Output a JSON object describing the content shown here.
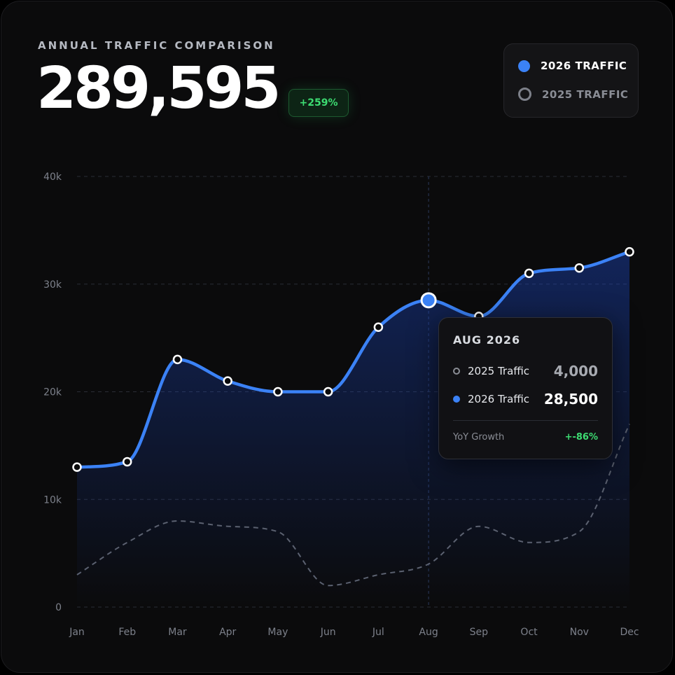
{
  "header": {
    "eyebrow": "ANNUAL TRAFFIC COMPARISON",
    "total": "289,595",
    "change_badge": "+259%"
  },
  "legend": {
    "items": [
      {
        "label": "2026 TRAFFIC",
        "style": "filled",
        "color": "#3b82f6"
      },
      {
        "label": "2025 TRAFFIC",
        "style": "hollow",
        "color": "#7d8089"
      }
    ]
  },
  "tooltip": {
    "title": "AUG 2026",
    "row_2025_label": "2025 Traffic",
    "row_2025_value": "4,000",
    "row_2026_label": "2026 Traffic",
    "row_2026_value": "28,500",
    "growth_label": "YoY Growth",
    "growth_value": "+-86%"
  },
  "colors": {
    "accent": "#3b82f6",
    "secondary_line": "#5b6170",
    "positive": "#3ddc72",
    "background": "#0b0b0c"
  },
  "chart_data": {
    "type": "line",
    "categories": [
      "Jan",
      "Feb",
      "Mar",
      "Apr",
      "May",
      "Jun",
      "Jul",
      "Aug",
      "Sep",
      "Oct",
      "Nov",
      "Dec"
    ],
    "series": [
      {
        "name": "2026 TRAFFIC",
        "values": [
          13000,
          13500,
          23000,
          21000,
          20000,
          20000,
          26000,
          28500,
          27000,
          31000,
          31500,
          33000
        ],
        "style": "solid-area"
      },
      {
        "name": "2025 TRAFFIC",
        "values": [
          3000,
          6000,
          8000,
          7500,
          7000,
          2000,
          3000,
          4000,
          7500,
          6000,
          7000,
          17000
        ],
        "style": "dashed"
      }
    ],
    "ylim": [
      0,
      40000
    ],
    "yticks": [
      0,
      10000,
      20000,
      30000,
      40000
    ],
    "ytick_labels": [
      "0",
      "10k",
      "20k",
      "30k",
      "40k"
    ],
    "grid": true,
    "highlight_index": 7,
    "legend_position": "top-right"
  }
}
